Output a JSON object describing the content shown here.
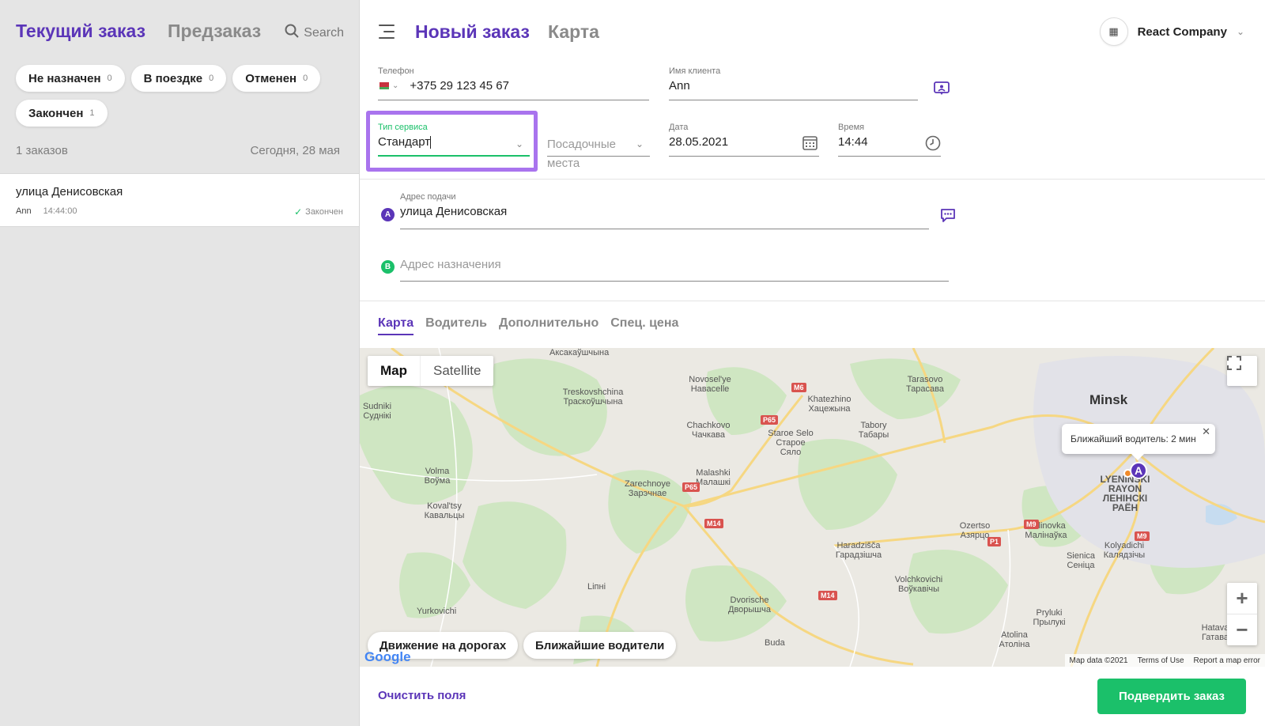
{
  "left_panel": {
    "tabs": {
      "current": "Текущий заказ",
      "preorder": "Предзаказ"
    },
    "search_label": "Search",
    "chips": [
      {
        "label": "Не назначен",
        "count": "0"
      },
      {
        "label": "В поездке",
        "count": "0"
      },
      {
        "label": "Отменен",
        "count": "0"
      },
      {
        "label": "Закончен",
        "count": "1"
      }
    ],
    "orders_count": "1 заказов",
    "orders_date": "Сегодня, 28 мая",
    "order": {
      "address": "улица Денисовская",
      "client": "Ann",
      "time": "14:44:00",
      "status": "Закончен"
    }
  },
  "header": {
    "title_active": "Новый заказ",
    "title_inactive": "Карта",
    "company": "React Company"
  },
  "form": {
    "phone_label": "Телефон",
    "phone_value": "+375 29 123 45 67",
    "client_label": "Имя клиента",
    "client_value": "Ann",
    "service_label": "Тип сервиса",
    "service_value": "Стандарт",
    "seats_placeholder": "Посадочные места",
    "date_label": "Дата",
    "date_value": "28.05.2021",
    "time_label": "Время",
    "time_value": "14:44",
    "pickup_label": "Адрес подачи",
    "pickup_value": "улица Денисовская",
    "destination_placeholder": "Адрес назначения"
  },
  "tabs": [
    "Карта",
    "Водитель",
    "Дополнительно",
    "Спец. цена"
  ],
  "map": {
    "type_map": "Map",
    "type_satellite": "Satellite",
    "tooltip": "Ближайший водитель: 2 мин",
    "marker_label": "A",
    "chip_traffic": "Движение на дорогах",
    "chip_drivers": "Ближайшие водители",
    "footer": {
      "data": "Map data ©2021",
      "terms": "Terms of Use",
      "report": "Report a map error"
    },
    "google": "Google",
    "places": [
      "Аксакаўшчына",
      "Novosel'ye Навасelle",
      "Tarasovo Тарасава",
      "Minsk",
      "Treskovshchina Траскоўшчына",
      "Khatezhino Хацежына",
      "Chachkovo Чачкава",
      "Staroe Selo Старое Сяло",
      "Tabory Табары",
      "Sudniki Суднікі",
      "Volma Воўма",
      "Koval'tsy Кавальцы",
      "Zarechnoye Зарэчнае",
      "Malashki Малашкі",
      "Ozertso Азярцо",
      "Malinovka Малінаўка",
      "Haradzišča Гарадзішча",
      "Sienica Сеніца",
      "Kolyadichi Калядзічы",
      "Volchkovichi Воўкавічы",
      "Dvorische Дворышча",
      "Pryluki Прылукі",
      "Atolina Атоліна",
      "Hatava Гатава",
      "Lіпні",
      "Yurkovichi",
      "Buda",
      "LYENINSKI RAYON ЛЕНІНСКІ РАЁН"
    ]
  },
  "bottom": {
    "clear": "Очистить поля",
    "confirm": "Подвердить заказ"
  },
  "colors": {
    "brand_purple": "#5b35b8",
    "confirm_green": "#1bc06a",
    "focus_outline": "#a974ee",
    "marker_driver": "#f08a2a"
  }
}
